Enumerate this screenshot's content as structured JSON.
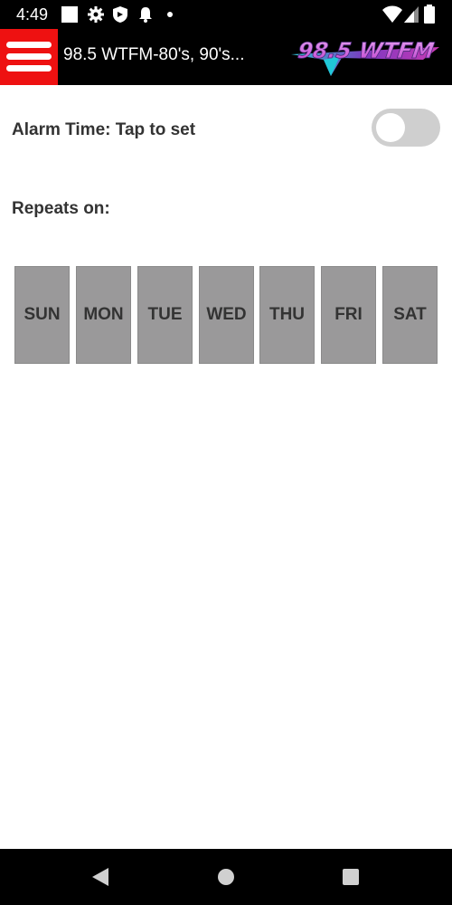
{
  "status_bar": {
    "time": "4:49",
    "icons": [
      "square-icon",
      "gear-icon",
      "shield-icon",
      "bell-icon",
      "dot-icon",
      "wifi-icon",
      "signal-icon",
      "battery-icon"
    ]
  },
  "header": {
    "menu_icon": "hamburger-menu-icon",
    "title": "98.5 WTFM-80's, 90's...",
    "logo_text": "98.5 WTFM",
    "colors": {
      "menu_bg": "#ee1111",
      "bar_bg": "#000000",
      "logo_cyan": "#33d6e8",
      "logo_purple": "#8a3fd6",
      "logo_magenta": "#e040c8"
    }
  },
  "alarm": {
    "label": "Alarm Time: Tap to set",
    "enabled": false
  },
  "repeats": {
    "label": "Repeats on:",
    "days": [
      {
        "label": "SUN",
        "selected": false
      },
      {
        "label": "MON",
        "selected": false
      },
      {
        "label": "TUE",
        "selected": false
      },
      {
        "label": "WED",
        "selected": false
      },
      {
        "label": "THU",
        "selected": false
      },
      {
        "label": "FRI",
        "selected": false
      },
      {
        "label": "SAT",
        "selected": false
      }
    ]
  },
  "nav_bar": {
    "icons": [
      "back-icon",
      "home-icon",
      "recents-icon"
    ]
  }
}
